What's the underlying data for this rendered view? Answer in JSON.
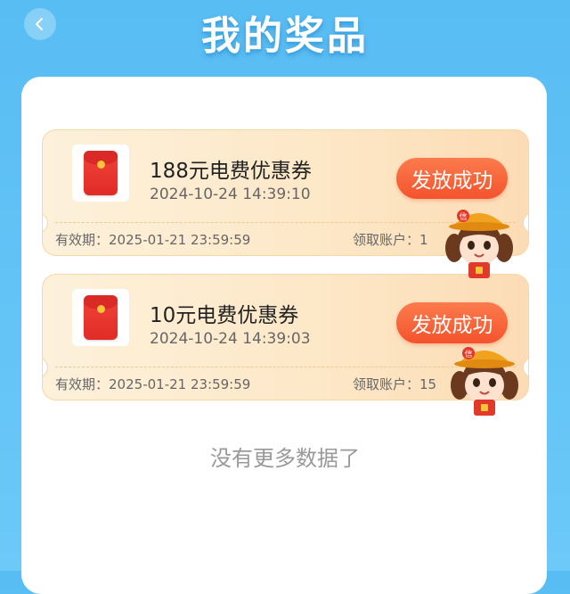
{
  "header": {
    "title": "我的奖品",
    "back_icon": "chevron-left-icon"
  },
  "prizes": [
    {
      "name": "188元电费优惠券",
      "time": "2024-10-24 14:39:10",
      "status": "发放成功",
      "expire_label": "有效期：",
      "expire_value": "2025-01-21 23:59:59",
      "account_label": "领取账户：",
      "account_value": "1",
      "icon": "red-envelope-icon"
    },
    {
      "name": "10元电费优惠券",
      "time": "2024-10-24 14:39:03",
      "status": "发放成功",
      "expire_label": "有效期：",
      "expire_value": "2025-01-21 23:59:59",
      "account_label": "领取账户：",
      "account_value": "15",
      "icon": "red-envelope-icon"
    }
  ],
  "footer": {
    "no_more": "没有更多数据了"
  },
  "mascot": {
    "hat_text": "信"
  },
  "colors": {
    "background": "#5fc1f5",
    "status_button": "#f4532d",
    "card_bg": "#fde8c8"
  }
}
